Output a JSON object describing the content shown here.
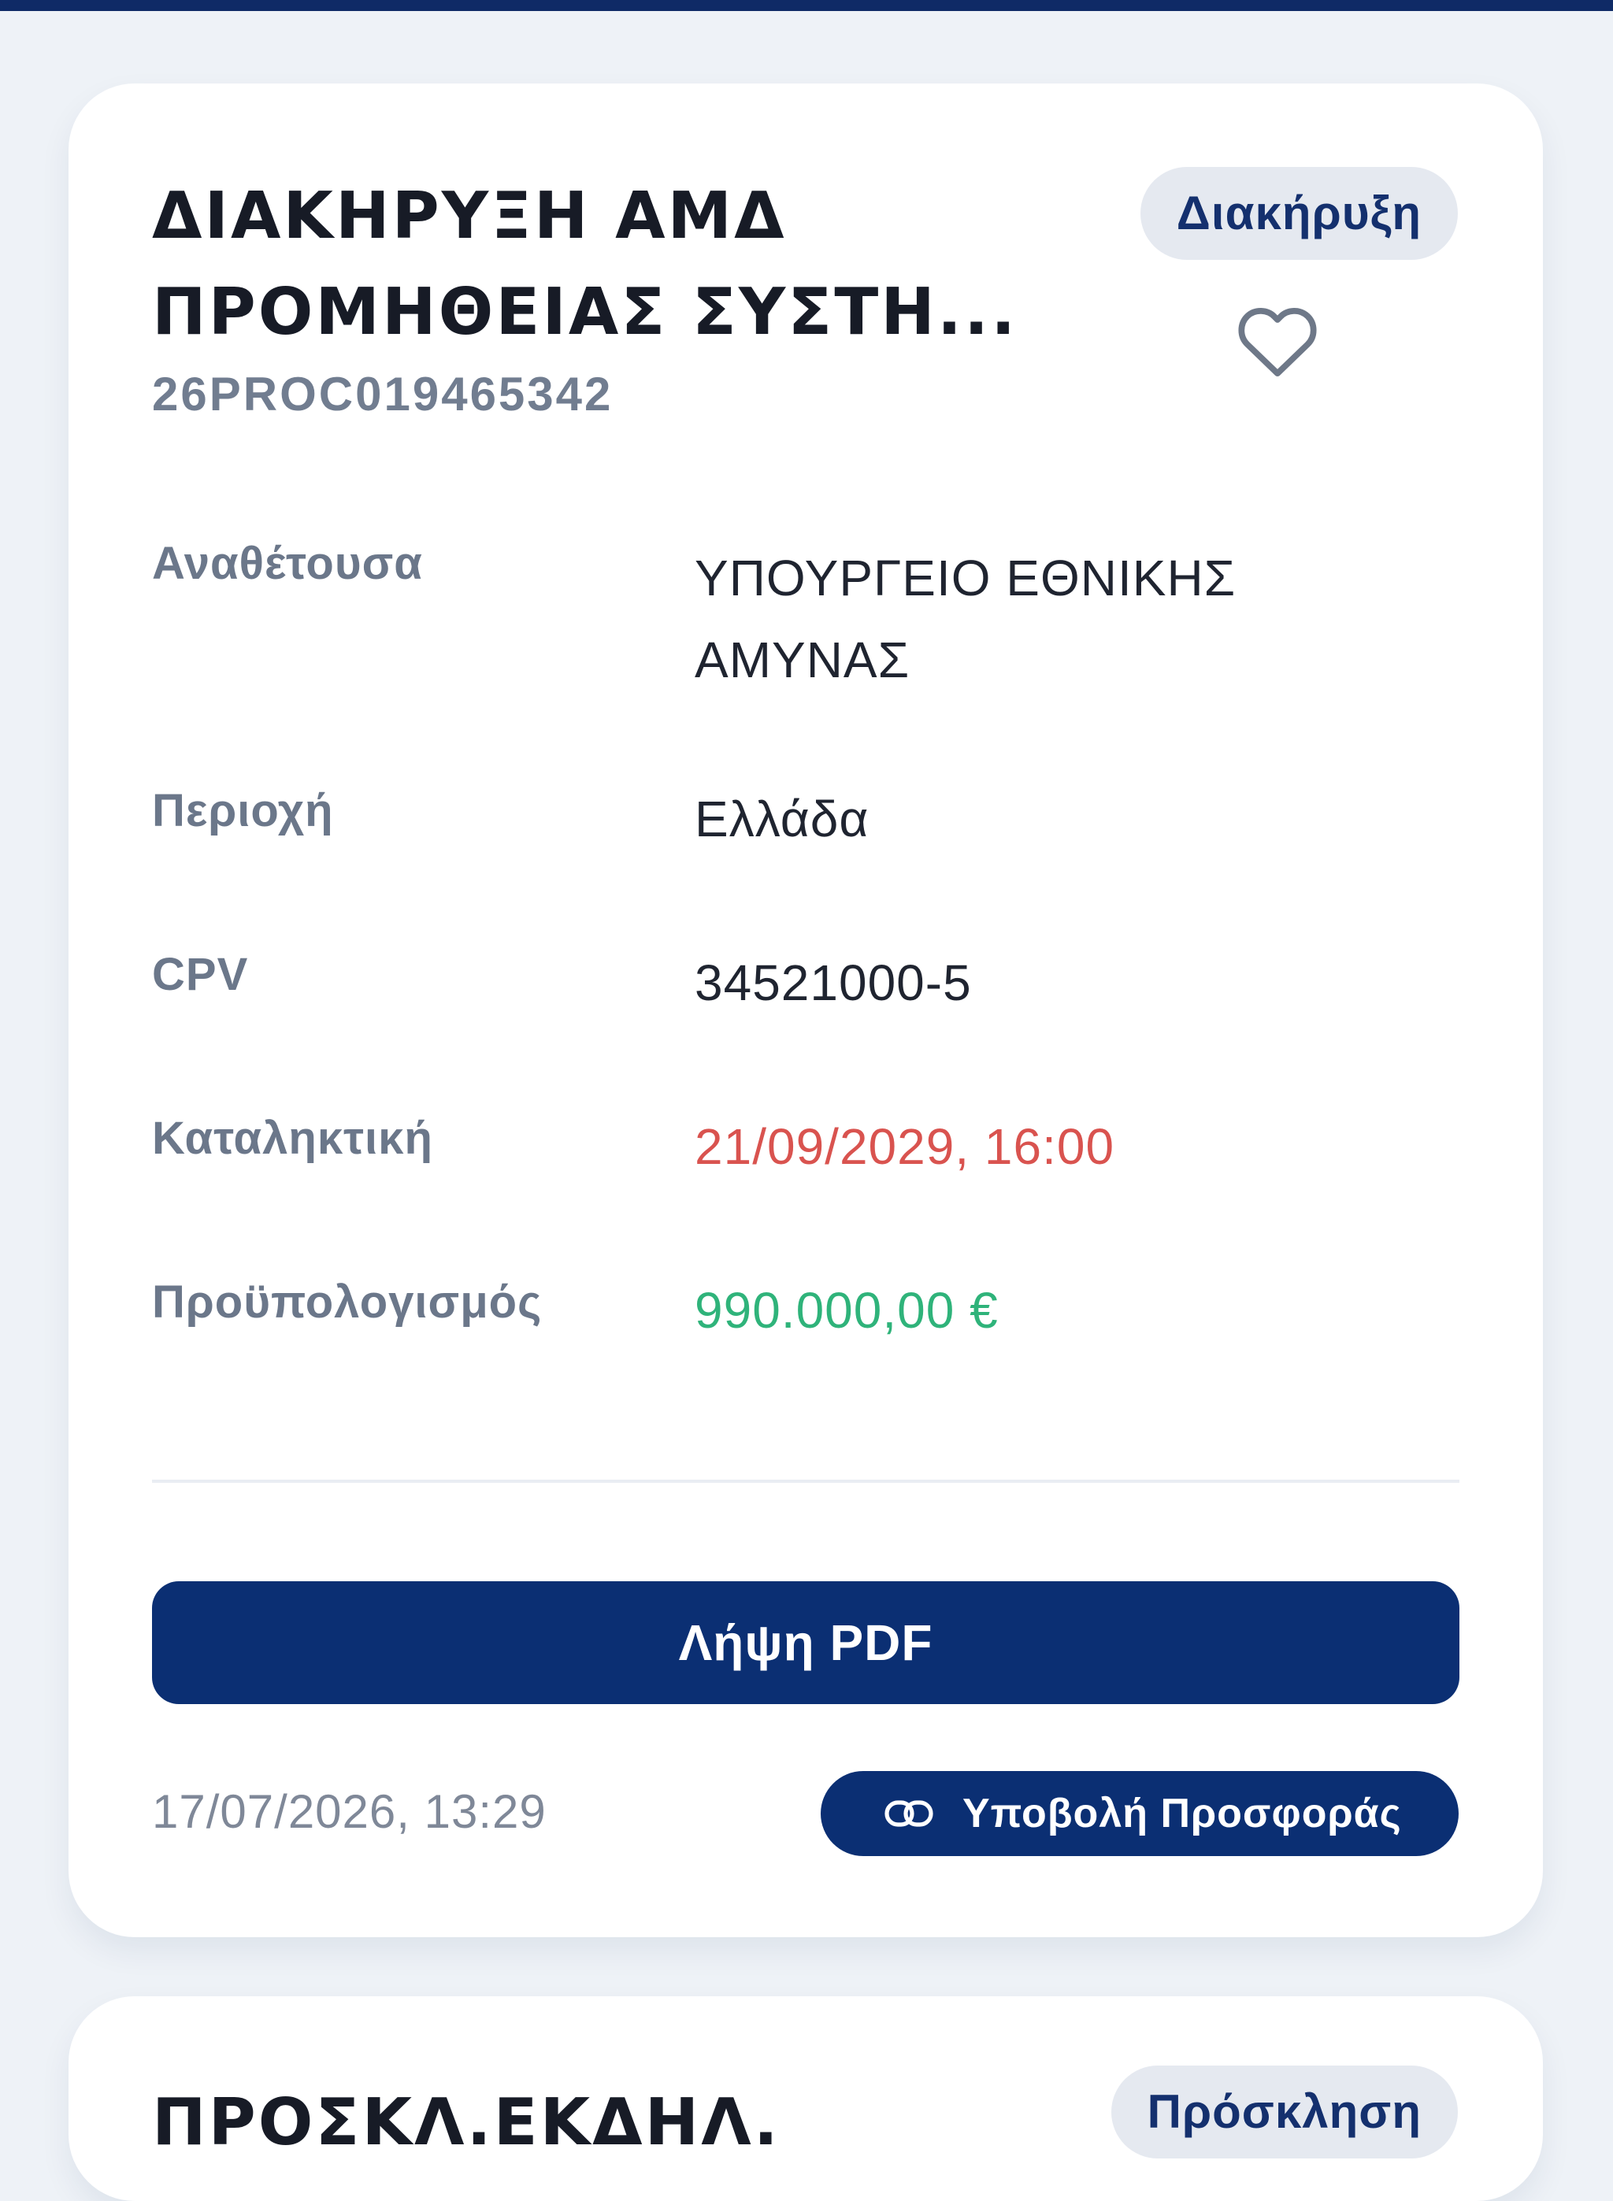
{
  "cards": [
    {
      "title": "ΔΙΑΚΗΡΥΞΗ ΑΜΔ\nΠΡΟΜΗΘΕΙΑΣ ΣΥΣΤΗ...",
      "reference": "26PROC019465342",
      "badge": "Διακήρυξη",
      "favorite_icon": "heart-outline-icon",
      "fields": [
        {
          "label": "Αναθέτουσα",
          "value": "ΥΠΟΥΡΓΕΙΟ ΕΘΝΙΚΗΣ ΑΜΥΝΑΣ"
        },
        {
          "label": "Περιοχή",
          "value": "Ελλάδα"
        },
        {
          "label": "CPV",
          "value": "34521000-5"
        },
        {
          "label": "Καταληκτική",
          "value": "21/09/2029, 16:00"
        },
        {
          "label": "Προϋπολογισμός",
          "value": "990.000,00 €"
        }
      ],
      "pdf_button_label": "Λήψη PDF",
      "published_date": "17/07/2026, 13:29",
      "offer_button": {
        "label": "Υποβολή Προσφοράς",
        "icon": "link-icon"
      }
    },
    {
      "title": "ΠΡΟΣΚΛ.ΕΚΔΗΛ.",
      "badge": "Πρόσκληση"
    }
  ],
  "colors": {
    "primary": "#0b2f73",
    "deadline": "#d9534f",
    "budget": "#2fb37a",
    "label": "#6b778a",
    "background": "#eef2f7"
  }
}
